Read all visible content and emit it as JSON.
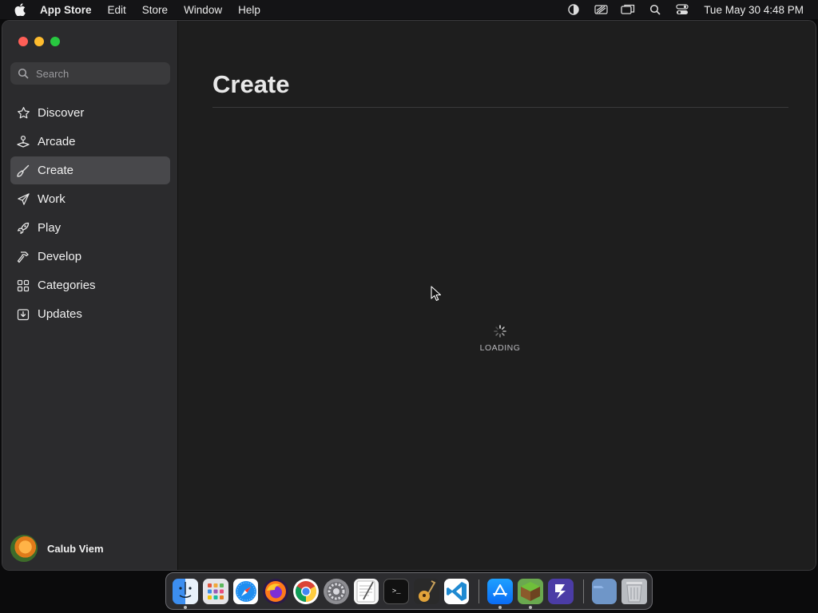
{
  "menubar": {
    "app_name": "App Store",
    "menus": [
      "Edit",
      "Store",
      "Window",
      "Help"
    ],
    "clock": "Tue May 30  4:48 PM",
    "status_icons": [
      "focus-icon",
      "battery-icon",
      "screen-mirroring-icon",
      "spotlight-icon",
      "control-center-icon"
    ]
  },
  "sidebar": {
    "search_placeholder": "Search",
    "items": [
      {
        "label": "Discover",
        "icon": "star-icon"
      },
      {
        "label": "Arcade",
        "icon": "joystick-icon"
      },
      {
        "label": "Create",
        "icon": "brush-icon",
        "active": true
      },
      {
        "label": "Work",
        "icon": "paper-plane-icon"
      },
      {
        "label": "Play",
        "icon": "rocket-icon"
      },
      {
        "label": "Develop",
        "icon": "hammer-icon"
      },
      {
        "label": "Categories",
        "icon": "grid-icon"
      },
      {
        "label": "Updates",
        "icon": "download-icon"
      }
    ],
    "profile_name": "Calub Viem"
  },
  "content": {
    "title": "Create",
    "loading_text": "LOADING"
  },
  "dock": {
    "apps": [
      "finder",
      "launchpad",
      "safari",
      "firefox",
      "chrome",
      "system-settings",
      "textedit",
      "terminal",
      "garageband",
      "vscode",
      "app-store",
      "minecraft",
      "jet-app",
      "downloads",
      "trash"
    ]
  },
  "colors": {
    "sidebar_bg": "#2b2b2d",
    "content_bg": "#1e1e1e",
    "active_item_bg": "#48484b",
    "close": "#ff5f57",
    "minimize": "#febc2e",
    "maximize": "#28c840"
  }
}
